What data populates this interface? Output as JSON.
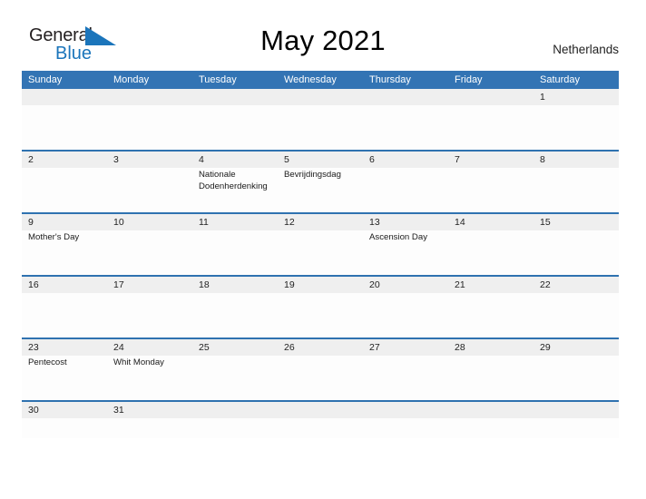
{
  "brand": {
    "name_part1": "General",
    "name_part2": "Blue",
    "colors": {
      "dark": "#231f20",
      "blue": "#1b75bb"
    }
  },
  "header": {
    "title": "May 2021",
    "country": "Netherlands"
  },
  "theme": {
    "header_blue": "#3374b4",
    "row_border_blue": "#2f72b0",
    "day_band_gray": "#efefef",
    "page_background": "#ffffff"
  },
  "calendar": {
    "month": "May",
    "year": "2021",
    "weekday_headers": [
      "Sunday",
      "Monday",
      "Tuesday",
      "Wednesday",
      "Thursday",
      "Friday",
      "Saturday"
    ],
    "weeks": [
      {
        "days": [
          {
            "number": "",
            "event": ""
          },
          {
            "number": "",
            "event": ""
          },
          {
            "number": "",
            "event": ""
          },
          {
            "number": "",
            "event": ""
          },
          {
            "number": "",
            "event": ""
          },
          {
            "number": "",
            "event": ""
          },
          {
            "number": "1",
            "event": ""
          }
        ]
      },
      {
        "days": [
          {
            "number": "2",
            "event": ""
          },
          {
            "number": "3",
            "event": ""
          },
          {
            "number": "4",
            "event": "Nationale Dodenherdenking"
          },
          {
            "number": "5",
            "event": "Bevrijdingsdag"
          },
          {
            "number": "6",
            "event": ""
          },
          {
            "number": "7",
            "event": ""
          },
          {
            "number": "8",
            "event": ""
          }
        ]
      },
      {
        "days": [
          {
            "number": "9",
            "event": "Mother's Day"
          },
          {
            "number": "10",
            "event": ""
          },
          {
            "number": "11",
            "event": ""
          },
          {
            "number": "12",
            "event": ""
          },
          {
            "number": "13",
            "event": "Ascension Day"
          },
          {
            "number": "14",
            "event": ""
          },
          {
            "number": "15",
            "event": ""
          }
        ]
      },
      {
        "days": [
          {
            "number": "16",
            "event": ""
          },
          {
            "number": "17",
            "event": ""
          },
          {
            "number": "18",
            "event": ""
          },
          {
            "number": "19",
            "event": ""
          },
          {
            "number": "20",
            "event": ""
          },
          {
            "number": "21",
            "event": ""
          },
          {
            "number": "22",
            "event": ""
          }
        ]
      },
      {
        "days": [
          {
            "number": "23",
            "event": "Pentecost"
          },
          {
            "number": "24",
            "event": "Whit Monday"
          },
          {
            "number": "25",
            "event": ""
          },
          {
            "number": "26",
            "event": ""
          },
          {
            "number": "27",
            "event": ""
          },
          {
            "number": "28",
            "event": ""
          },
          {
            "number": "29",
            "event": ""
          }
        ]
      },
      {
        "days": [
          {
            "number": "30",
            "event": ""
          },
          {
            "number": "31",
            "event": ""
          },
          {
            "number": "",
            "event": ""
          },
          {
            "number": "",
            "event": ""
          },
          {
            "number": "",
            "event": ""
          },
          {
            "number": "",
            "event": ""
          },
          {
            "number": "",
            "event": ""
          }
        ]
      }
    ]
  }
}
